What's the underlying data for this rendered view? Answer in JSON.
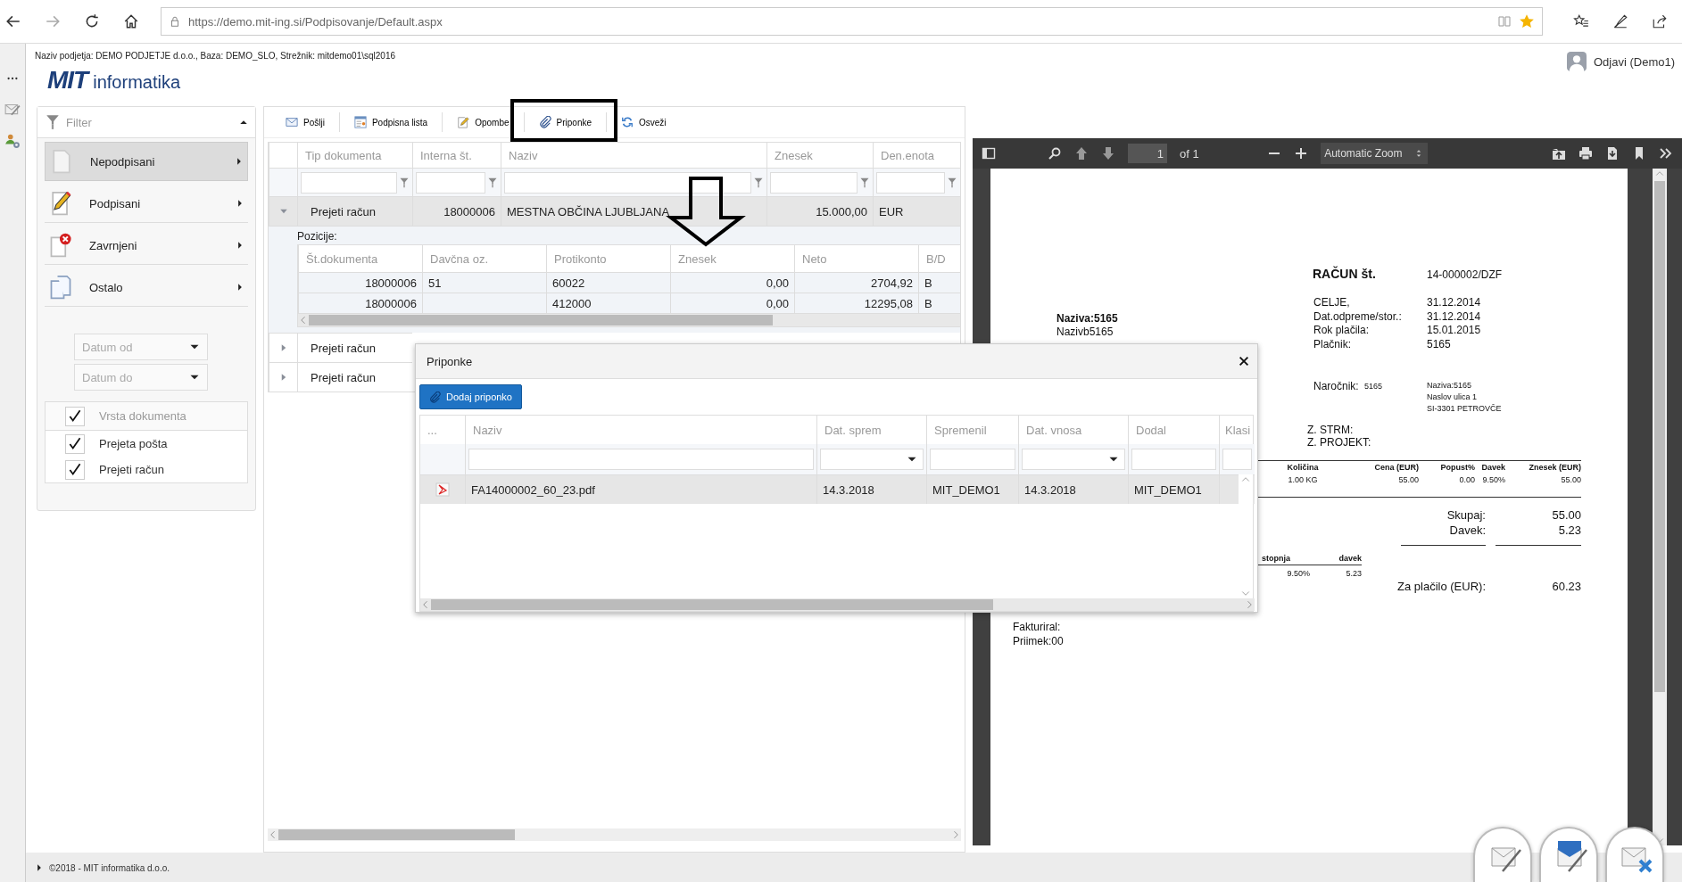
{
  "browser": {
    "url": "https://demo.mit-ing.si/Podpisovanje/Default.aspx",
    "favorite": true
  },
  "header": {
    "info": "Naziv podjetja: DEMO PODJETJE d.o.o., Baza: DEMO_SLO, Strežnik: mitdemo01\\sql2016",
    "logo_mark": "MIT",
    "logo_text": "informatika",
    "user": "Odjavi (Demo1)"
  },
  "filter": {
    "title": "Filter",
    "expanded": true,
    "items": [
      {
        "label": "Nepodpisani",
        "kind": "blank",
        "selected": true
      },
      {
        "label": "Podpisani",
        "kind": "signed",
        "selected": false
      },
      {
        "label": "Zavrnjeni",
        "kind": "rejected",
        "selected": false
      },
      {
        "label": "Ostalo",
        "kind": "pages",
        "selected": false
      }
    ],
    "date_from": {
      "placeholder": "Datum od"
    },
    "date_to": {
      "placeholder": "Datum do"
    },
    "doc_types": {
      "header": "Vrsta dokumenta",
      "checked": true,
      "items": [
        {
          "label": "Prejeta pošta",
          "checked": true
        },
        {
          "label": "Prejeti račun",
          "checked": true
        }
      ]
    }
  },
  "toolbar": [
    {
      "label": "Pošlji",
      "kind": "mail"
    },
    {
      "label": "Podpisna lista",
      "kind": "list"
    },
    {
      "label": "Opombe",
      "kind": "note"
    },
    {
      "label": "Priponke",
      "kind": "clip"
    },
    {
      "label": "Osveži",
      "kind": "refresh"
    }
  ],
  "grid": {
    "columns": [
      "Tip dokumenta",
      "Interna št.",
      "Naziv",
      "Znesek",
      "Den.enota"
    ],
    "rows": [
      {
        "expanded": true,
        "cells": [
          "Prejeti račun",
          "18000006",
          "MESTNA OBČINA LJUBLJANA",
          "15.000,00",
          "EUR"
        ],
        "detail": {
          "title": "Pozicije:",
          "columns": [
            "Št.dokumenta",
            "Davčna oz.",
            "Protikonto",
            "Znesek",
            "Neto",
            "B/D"
          ],
          "rows": [
            [
              "18000006",
              "51",
              "60022",
              "0,00",
              "2704,92",
              "B"
            ],
            [
              "18000006",
              "",
              "412000",
              "0,00",
              "12295,08",
              "B"
            ]
          ]
        }
      },
      {
        "expanded": false,
        "cells": [
          "Prejeti račun"
        ]
      },
      {
        "expanded": false,
        "cells": [
          "Prejeti račun"
        ]
      }
    ]
  },
  "pdf_viewer": {
    "page": "1",
    "page_count": "of 1",
    "zoom": "Automatic Zoom",
    "document": {
      "title": "RAČUN št.",
      "number": "14-000002/DZF",
      "info": [
        {
          "label": "CELJE,",
          "value": "31.12.2014"
        },
        {
          "label": "Dat.odpreme/stor.:",
          "value": "31.12.2014"
        },
        {
          "label": "Rok plačila:",
          "value": "15.01.2015"
        },
        {
          "label": "Plačnik:",
          "value": "5165"
        }
      ],
      "buyer": [
        "Naziva:5165",
        "Nazivb5165"
      ],
      "customer": {
        "label": "Naročnik:",
        "code": "5165",
        "address": [
          "Naziva:5165",
          "Naslov ulica 1",
          "SI-3301 PETROVČE"
        ]
      },
      "refs": [
        "Z. STRM:",
        "Z. PROJEKT:"
      ],
      "items_header": [
        "Količina",
        "Cena (EUR)",
        "Popust%",
        "Davek",
        "Znesek (EUR)"
      ],
      "items_row": [
        "1.00 KG",
        "55.00",
        "0.00",
        "9.50%",
        "55.00"
      ],
      "totals": [
        {
          "label": "Skupaj:",
          "value": "55.00"
        },
        {
          "label": "Davek:",
          "value": "5.23"
        }
      ],
      "tax_header": [
        "stopnja",
        "davek"
      ],
      "tax_row": [
        "9.50%",
        "5.23"
      ],
      "payable": {
        "label": "Za plačilo (EUR):",
        "value": "60.23"
      },
      "signature": [
        "Fakturiral:",
        "Priimek:00"
      ]
    }
  },
  "dialog": {
    "title": "Priponke",
    "add_button": "Dodaj priponko",
    "columns": [
      {
        "label": "...",
        "kind": "none"
      },
      {
        "label": "Naziv",
        "kind": "text"
      },
      {
        "label": "Dat. sprem",
        "kind": "date"
      },
      {
        "label": "Spremenil",
        "kind": "text"
      },
      {
        "label": "Dat. vnosa",
        "kind": "date"
      },
      {
        "label": "Dodal",
        "kind": "text"
      },
      {
        "label": "Klasi",
        "kind": "text"
      }
    ],
    "rows": [
      {
        "selected": true,
        "cells": [
          "",
          "FA14000002_60_23.pdf",
          "14.3.2018",
          "MIT_DEMO1",
          "14.3.2018",
          "MIT_DEMO1"
        ]
      }
    ]
  },
  "footer": {
    "copyright": "©2018 - MIT informatika d.o.o."
  },
  "actions": [
    {
      "kind": "sign"
    },
    {
      "kind": "send"
    },
    {
      "kind": "reject"
    }
  ]
}
